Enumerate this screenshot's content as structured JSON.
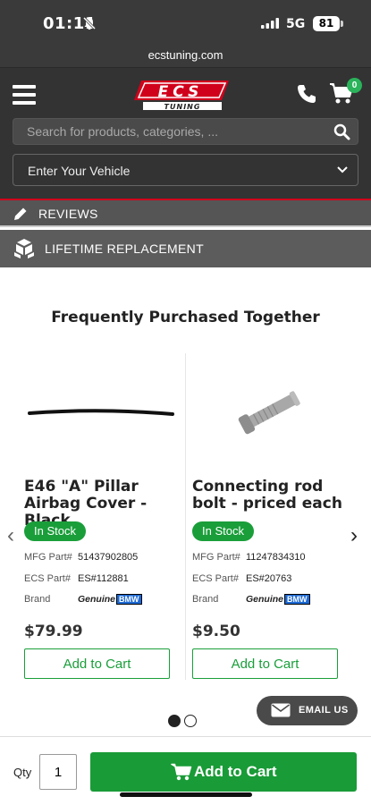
{
  "status_bar": {
    "time": "01:11",
    "network": "5G",
    "battery": "81"
  },
  "url": "ecstuning.com",
  "header": {
    "logo_text_top": "ECS",
    "logo_text_bottom": "TUNING",
    "cart_count": "0",
    "search_placeholder": "Search for products, categories, ...",
    "vehicle_select": "Enter Your Vehicle"
  },
  "bars": {
    "reviews": "REVIEWS",
    "lifetime": "LIFETIME REPLACEMENT"
  },
  "section_title": "Frequently Purchased Together",
  "products": [
    {
      "name": "E46 \"A\" Pillar Airbag Cover - Black",
      "stock": "In Stock",
      "mfg_label": "MFG Part#",
      "mfg": "51437902805",
      "ecs_label": "ECS Part#",
      "ecs": "ES#112881",
      "brand_label": "Brand",
      "brand": "Genuine",
      "brand_badge": "BMW",
      "price": "$79.99",
      "button": "Add to Cart"
    },
    {
      "name": "Connecting rod bolt - priced each",
      "stock": "In Stock",
      "mfg_label": "MFG Part#",
      "mfg": "11247834310",
      "ecs_label": "ECS Part#",
      "ecs": "ES#20763",
      "brand_label": "Brand",
      "brand": "Genuine",
      "brand_badge": "BMW",
      "price": "$9.50",
      "button": "Add to Cart"
    }
  ],
  "carousel": {
    "prev": "‹",
    "next": "›"
  },
  "email_us": "EMAIL US",
  "footer": {
    "qty_label": "Qty",
    "qty_value": "1",
    "add_to_cart": "Add to Cart"
  },
  "colors": {
    "accent_green": "#1a9e3a",
    "brand_red": "#d0021b",
    "header_bg": "#333333"
  }
}
